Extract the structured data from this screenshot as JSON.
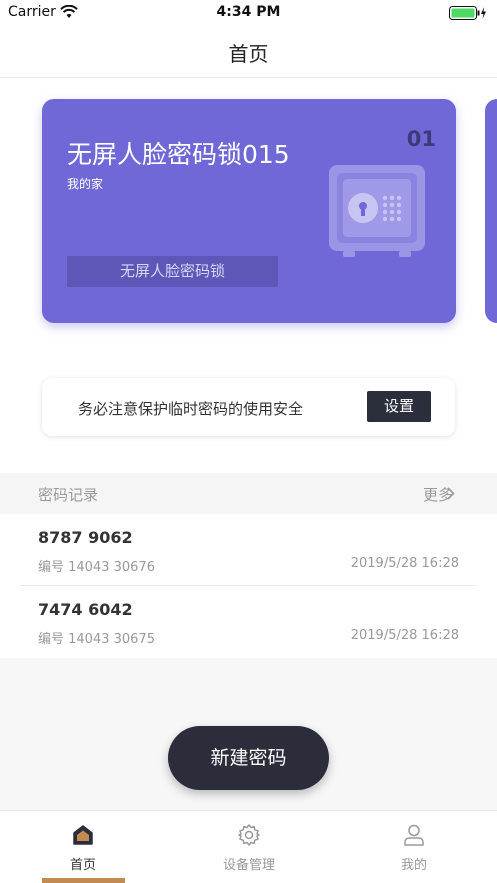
{
  "status_bar": {
    "carrier": "Carrier",
    "time": "4:34 PM"
  },
  "nav": {
    "title": "首页"
  },
  "device_card": {
    "title": "无屏人脸密码锁015",
    "subtitle": "我的家",
    "number": "01",
    "type_button": "无屏人脸密码锁",
    "color": "#7068d6",
    "icon": "safe-icon"
  },
  "notice": {
    "text": "务必注意保护临时密码的使用安全",
    "button": "设置"
  },
  "records": {
    "title": "密码记录",
    "more": "更多",
    "items": [
      {
        "code": "8787 9062",
        "id": "编号 14043 30676",
        "time": "2019/5/28 16:28"
      },
      {
        "code": "7474 6042",
        "id": "编号 14043 30675",
        "time": "2019/5/28 16:28"
      }
    ]
  },
  "new_button": "新建密码",
  "tabs": [
    {
      "label": "首页",
      "icon": "home-icon",
      "active": true
    },
    {
      "label": "设备管理",
      "icon": "gear-icon",
      "active": false
    },
    {
      "label": "我的",
      "icon": "user-icon",
      "active": false
    }
  ],
  "accent_color": "#c28b54"
}
